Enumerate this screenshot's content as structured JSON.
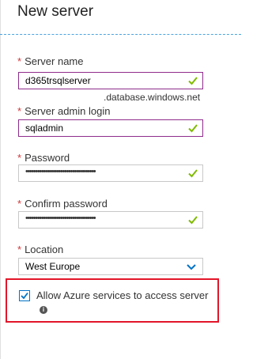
{
  "blade": {
    "title": "New server"
  },
  "form": {
    "required_marker": "*",
    "server_name": {
      "label": "Server name",
      "value": "d365trsqlserver",
      "suffix": ".database.windows.net"
    },
    "admin_login": {
      "label": "Server admin login",
      "value": "sqladmin"
    },
    "password": {
      "label": "Password",
      "value": "••••••••••••••••••••••••••••••••••••"
    },
    "confirm_password": {
      "label": "Confirm password",
      "value": "••••••••••••••••••••••••••••••••••••"
    },
    "location": {
      "label": "Location",
      "value": "West Europe"
    },
    "allow_azure": {
      "label": "Allow Azure services to access server",
      "checked": true,
      "info_icon": "i"
    }
  },
  "colors": {
    "focus_border": "#8e2c8b",
    "valid_check": "#7fba00",
    "chevron": "#0072c6",
    "highlight": "#e3152a",
    "required": "#d13438"
  },
  "icons": [
    "check-icon",
    "chevron-down-icon",
    "checkbox-check-icon",
    "info-icon"
  ]
}
